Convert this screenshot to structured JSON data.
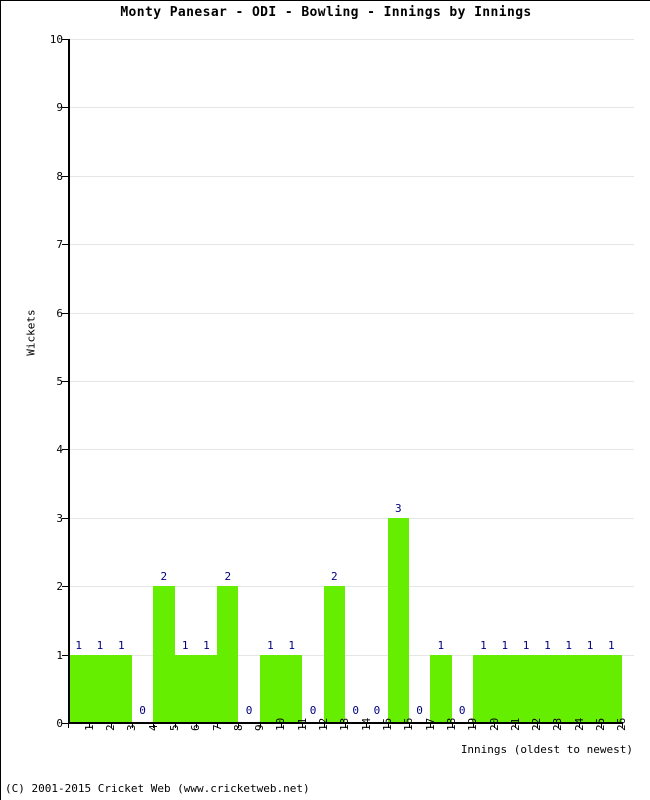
{
  "chart_data": {
    "type": "bar",
    "title": "Monty Panesar - ODI - Bowling - Innings by Innings",
    "xlabel": "Innings (oldest to newest)",
    "ylabel": "Wickets",
    "categories": [
      "1",
      "2",
      "3",
      "4",
      "5",
      "6",
      "7",
      "8",
      "9",
      "10",
      "11",
      "12",
      "13",
      "14",
      "15",
      "16",
      "17",
      "18",
      "19",
      "20",
      "21",
      "22",
      "23",
      "24",
      "25",
      "26"
    ],
    "values": [
      1,
      1,
      1,
      0,
      2,
      1,
      1,
      2,
      0,
      1,
      1,
      0,
      2,
      0,
      0,
      3,
      0,
      1,
      0,
      1,
      1,
      1,
      1,
      1,
      1,
      1
    ],
    "ylim": [
      0,
      10
    ],
    "yticks": [
      0,
      1,
      2,
      3,
      4,
      5,
      6,
      7,
      8,
      9,
      10
    ],
    "ytick_labels": [
      "0",
      "1",
      "2",
      "3",
      "4",
      "5",
      "6",
      "7",
      "8",
      "9",
      "10"
    ],
    "grid": true,
    "legend": false,
    "bar_color": "#66ee00",
    "value_label_color": "#000080",
    "grid_color": "#e6e6e6",
    "axis_color": "#000000"
  },
  "footer": {
    "copyright": "(C) 2001-2015 Cricket Web (www.cricketweb.net)"
  }
}
